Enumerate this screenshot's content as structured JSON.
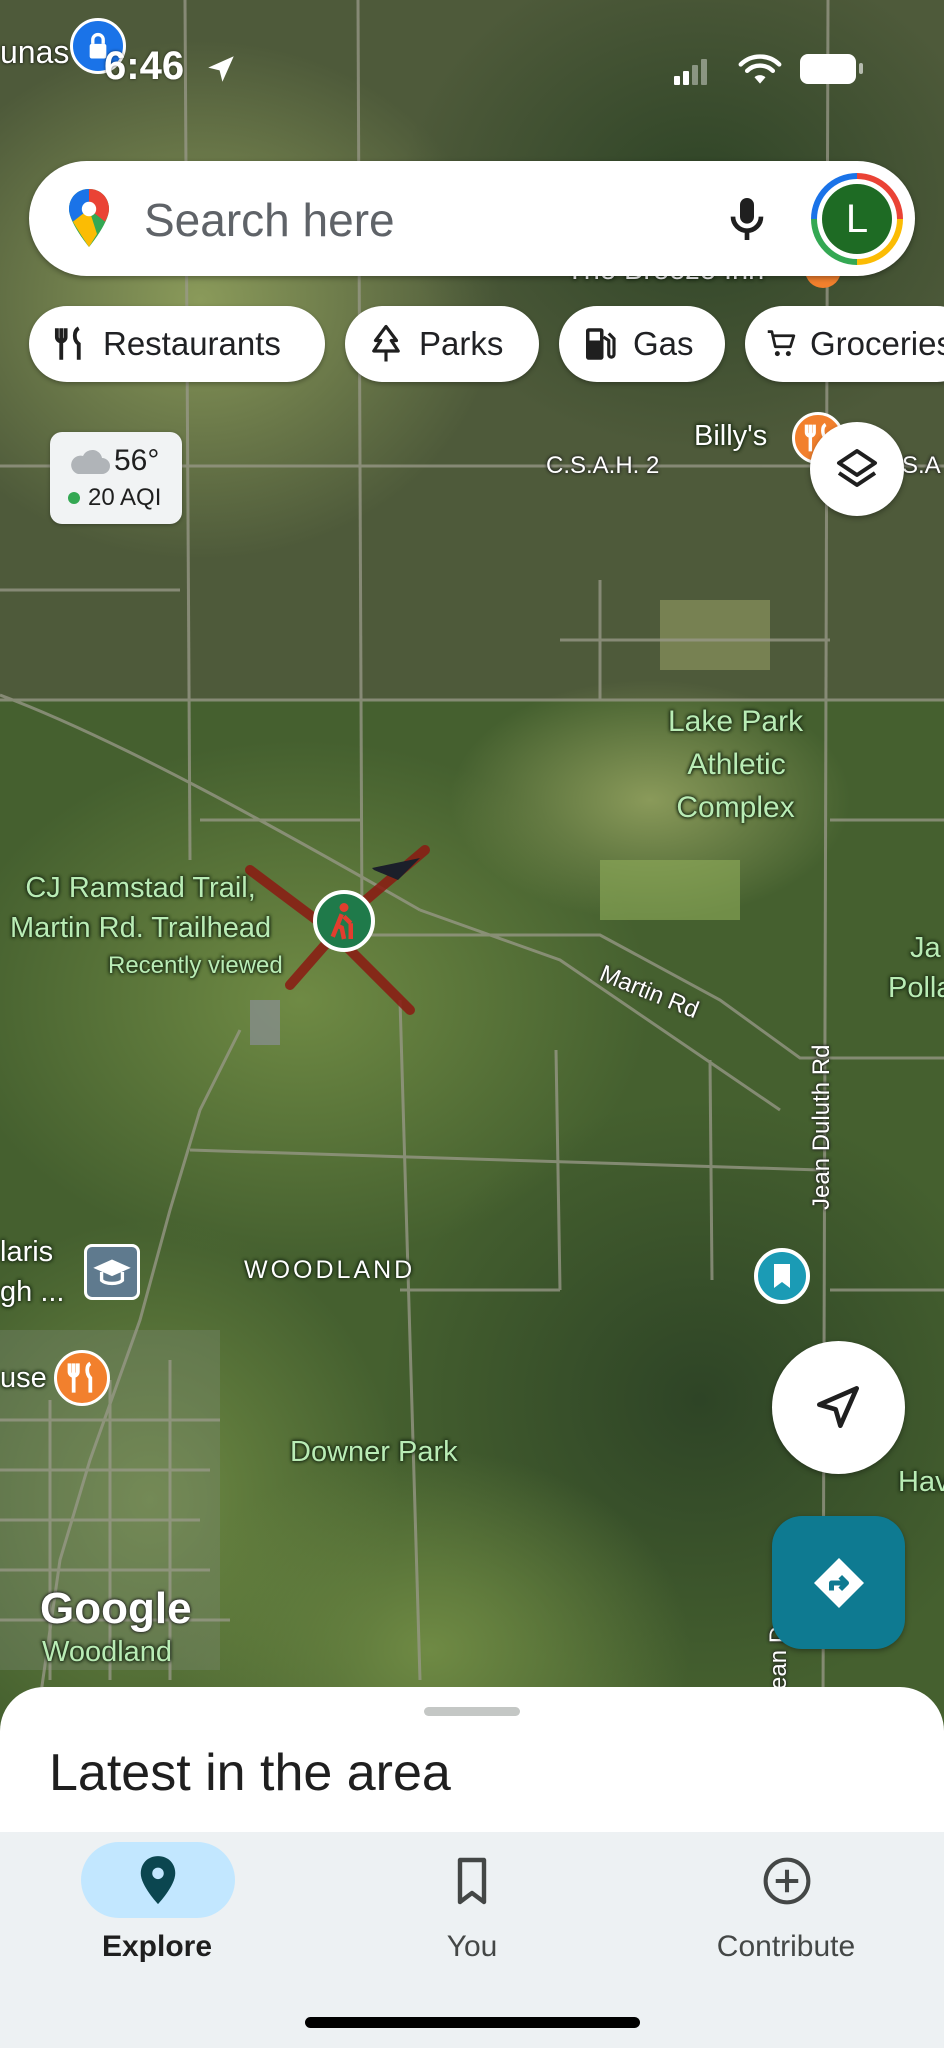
{
  "status_bar": {
    "time": "6:46",
    "edge_label": "unas"
  },
  "search": {
    "placeholder": "Search here",
    "avatar_letter": "L"
  },
  "chips": [
    {
      "label": "Restaurants",
      "icon": "fork-knife-icon"
    },
    {
      "label": "Parks",
      "icon": "tree-icon"
    },
    {
      "label": "Gas",
      "icon": "gas-pump-icon"
    },
    {
      "label": "Groceries",
      "icon": "cart-icon"
    }
  ],
  "weather": {
    "temp": "56°",
    "aqi": "20 AQI",
    "aqi_color": "#34a853"
  },
  "map": {
    "labels": {
      "breeze_inn": "The Breeze Inn",
      "billys": "Billy's",
      "csah_left": "C.S.A.H. 2",
      "csah_right": "S.A",
      "lake_park": [
        "Lake Park",
        "Athletic",
        "Complex"
      ],
      "trail_name": [
        "CJ Ramstad Trail,",
        "Martin Rd. Trailhead"
      ],
      "recently_viewed": "Recently viewed",
      "martin_rd": "Martin Rd",
      "jean_duluth_rd": "Jean Duluth Rd",
      "jean_duluth_rd_short": "ean D",
      "ja_polla": [
        "Ja",
        "Polla"
      ],
      "laris": [
        "laris",
        "gh ..."
      ],
      "use": "use",
      "woodland_area": "WOODLAND",
      "downer_park": "Downer Park",
      "hav": "Hav",
      "google": "Google",
      "woodland_town": "Woodland"
    }
  },
  "sheet": {
    "title": "Latest in the area"
  },
  "nav": [
    {
      "label": "Explore",
      "icon": "location-pin-icon",
      "active": true
    },
    {
      "label": "You",
      "icon": "bookmark-icon",
      "active": false
    },
    {
      "label": "Contribute",
      "icon": "plus-circle-icon",
      "active": false
    }
  ],
  "colors": {
    "accent": "#0e7a91",
    "explore_pill": "#c2e7ff",
    "pin_orange": "#f2802d"
  }
}
